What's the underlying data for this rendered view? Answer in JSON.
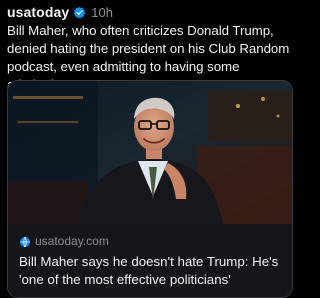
{
  "post": {
    "username": "usatoday",
    "verified_icon": "verified-badge-icon",
    "timestamp": "10h",
    "text": "Bill Maher, who often criticizes Donald Trump, denied hating the president on his Club Random podcast, even admitting to having some admiration."
  },
  "link_card": {
    "image_description_icon": "photo-thumbnail",
    "domain_icon": "globe-icon",
    "domain": "usatoday.com",
    "title": "Bill Maher says he doesn't hate Trump: He's 'one of the most effective politicians'"
  },
  "colors": {
    "background": "#000000",
    "text_primary": "#f2f2f2",
    "text_secondary": "#8e8e93",
    "verified_blue": "#0095f6",
    "card_border": "#3a3a3c"
  }
}
